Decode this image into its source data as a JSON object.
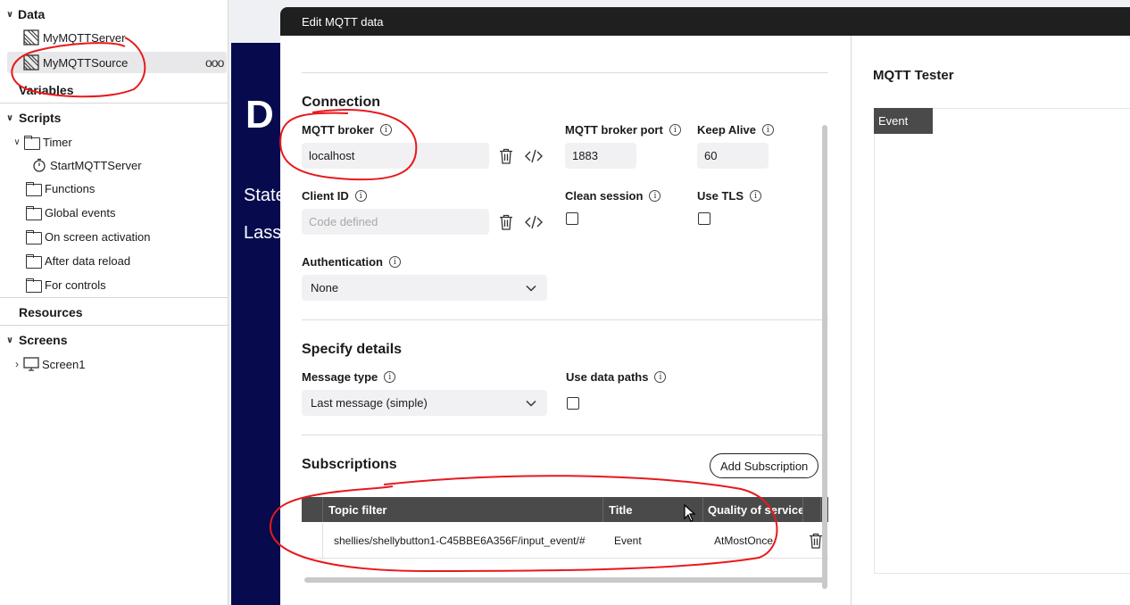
{
  "sidebar": {
    "sections": {
      "data": "Data",
      "variables": "Variables",
      "scripts": "Scripts",
      "resources": "Resources",
      "screens": "Screens"
    },
    "data_items": [
      "MyMQTTServer",
      "MyMQTTSource"
    ],
    "more_label": "ooo",
    "scripts": {
      "timer": "Timer",
      "timer_child": "StartMQTTServer",
      "folders": [
        "Functions",
        "Global events",
        "On screen activation",
        "After data reload",
        "For controls"
      ]
    },
    "screens": [
      "Screen1"
    ]
  },
  "app_preview": {
    "big_letter": "D",
    "line1": "State",
    "line2": "Lass"
  },
  "dialog": {
    "title": "Edit MQTT data",
    "connection": {
      "title": "Connection",
      "broker_label": "MQTT broker",
      "broker_value": "localhost",
      "port_label": "MQTT broker port",
      "port_value": "1883",
      "keepalive_label": "Keep Alive",
      "keepalive_value": "60",
      "clientid_label": "Client ID",
      "clientid_placeholder": "Code defined",
      "clean_session_label": "Clean session",
      "use_tls_label": "Use TLS",
      "auth_label": "Authentication",
      "auth_value": "None"
    },
    "details": {
      "title": "Specify details",
      "message_type_label": "Message type",
      "message_type_value": "Last message (simple)",
      "use_data_paths_label": "Use data paths"
    },
    "subscriptions": {
      "title": "Subscriptions",
      "add_button": "Add Subscription",
      "columns": [
        "Topic filter",
        "Title",
        "Quality of service"
      ],
      "rows": [
        {
          "topic": "shellies/shellybutton1-C45BBE6A356F/input_event/#",
          "title": "Event",
          "qos": "AtMostOnce"
        }
      ]
    },
    "tester": {
      "title": "MQTT Tester",
      "tab": "Event"
    }
  },
  "colors": {
    "title_bar": "#1f1f1f",
    "table_header": "#4a4a4a",
    "app_preview_bg": "#070b4e",
    "annotation": "#e8191c"
  },
  "icons": [
    "chevron-down-icon",
    "chevron-right-icon",
    "data-source-icon",
    "folder-icon",
    "timer-icon",
    "screen-icon",
    "info-icon",
    "trash-icon",
    "code-icon",
    "mouse-cursor-icon"
  ]
}
